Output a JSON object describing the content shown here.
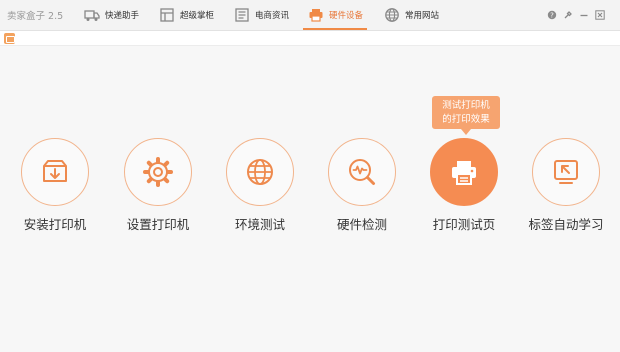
{
  "app": {
    "title": "卖家盒子 2.5"
  },
  "tabs": [
    {
      "label": "快递助手",
      "icon": "truck-icon"
    },
    {
      "label": "超级掌柜",
      "icon": "shop-icon"
    },
    {
      "label": "电商资讯",
      "icon": "news-icon"
    },
    {
      "label": "硬件设备",
      "icon": "printer-icon",
      "active": true
    },
    {
      "label": "常用网站",
      "icon": "globe-icon"
    }
  ],
  "window_controls": [
    "help-icon",
    "settings-icon",
    "minimize-icon",
    "close-icon"
  ],
  "devices": [
    {
      "label": "安装打印机",
      "icon": "download-box-icon"
    },
    {
      "label": "设置打印机",
      "icon": "gear-icon"
    },
    {
      "label": "环境测试",
      "icon": "globe-icon"
    },
    {
      "label": "硬件检测",
      "icon": "magnify-pulse-icon"
    },
    {
      "label": "打印测试页",
      "icon": "printer-icon",
      "active": true
    },
    {
      "label": "标签自动学习",
      "icon": "screen-cursor-icon"
    }
  ],
  "tooltip": {
    "line1": "测试打印机",
    "line2": "的打印效果"
  },
  "colors": {
    "accent": "#f58c52",
    "accent_light": "#f2b48c",
    "active_tab": "#e8783a"
  }
}
